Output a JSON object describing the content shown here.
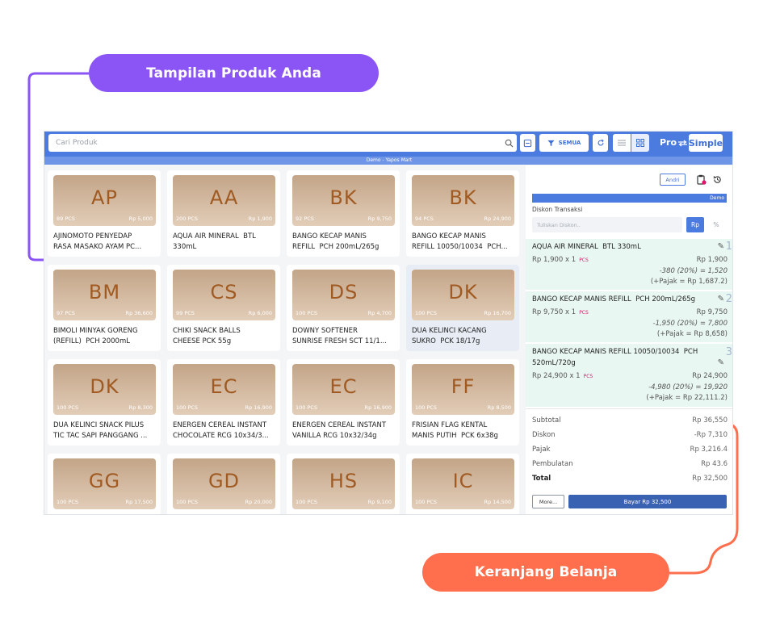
{
  "callouts": {
    "products": "Tampilan Produk Anda",
    "cart": "Keranjang Belanja"
  },
  "colors": {
    "callout_products": "#8b55f5",
    "callout_cart": "#ff6f4d",
    "brand_blue": "#4c7be0",
    "pcs_tag": "#e0136d"
  },
  "toolbar": {
    "search_placeholder": "Cari Produk",
    "filter_label": "SEMUA",
    "mode_pro": "Pro",
    "mode_simple": "Simple",
    "icons": [
      "search-icon",
      "barcode-icon",
      "filter-icon",
      "refresh-icon",
      "list-view-icon",
      "grid-view-icon",
      "toggle-icon"
    ]
  },
  "banner": "Demo - Yapos Mart",
  "products": [
    {
      "code": "AP",
      "qty": "89 PCS",
      "price": "Rp 5,000",
      "name": "AJINOMOTO PENYEDAP\nRASA MASAKO AYAM PC..."
    },
    {
      "code": "AA",
      "qty": "200 PCS",
      "price": "Rp 1,900",
      "name": "AQUA AIR MINERAL  BTL\n330mL"
    },
    {
      "code": "BK",
      "qty": "92 PCS",
      "price": "Rp 9,750",
      "name": "BANGO KECAP MANIS\nREFILL  PCH 200mL/265g"
    },
    {
      "code": "BK",
      "qty": "94 PCS",
      "price": "Rp 24,900",
      "name": "BANGO KECAP MANIS\nREFILL 10050/10034  PCH..."
    },
    {
      "code": "BM",
      "qty": "97 PCS",
      "price": "Rp 36,600",
      "name": "BIMOLI MINYAK GORENG\n(REFILL)  PCH 2000mL"
    },
    {
      "code": "CS",
      "qty": "99 PCS",
      "price": "Rp 6,000",
      "name": "CHIKI SNACK BALLS\nCHEESE PCK 55g"
    },
    {
      "code": "DS",
      "qty": "100 PCS",
      "price": "Rp 4,700",
      "name": "DOWNY SOFTENER\nSUNRISE FRESH SCT 11/1..."
    },
    {
      "code": "DK",
      "qty": "100 PCS",
      "price": "Rp 16,700",
      "name": "DUA KELINCI KACANG\nSUKRO  PCK 18/17g"
    },
    {
      "code": "DK",
      "qty": "100 PCS",
      "price": "Rp 8,300",
      "name": "DUA KELINCI SNACK PILUS\nTIC TAC SAPI PANGGANG ..."
    },
    {
      "code": "EC",
      "qty": "100 PCS",
      "price": "Rp 16,900",
      "name": "ENERGEN CEREAL INSTANT\nCHOCOLATE RCG 10x34/3..."
    },
    {
      "code": "EC",
      "qty": "100 PCS",
      "price": "Rp 16,900",
      "name": "ENERGEN CEREAL INSTANT\nVANILLA RCG 10x32/34g"
    },
    {
      "code": "FF",
      "qty": "100 PCS",
      "price": "Rp 8,500",
      "name": "FRISIAN FLAG KENTAL\nMANIS PUTIH  PCK 6x38g"
    },
    {
      "code": "GG",
      "qty": "100 PCS",
      "price": "Rp 17,500",
      "name": ""
    },
    {
      "code": "GD",
      "qty": "100 PCS",
      "price": "Rp 20,000",
      "name": ""
    },
    {
      "code": "HS",
      "qty": "100 PCS",
      "price": "Rp 9,100",
      "name": ""
    },
    {
      "code": "IC",
      "qty": "100 PCS",
      "price": "Rp 14,500",
      "name": ""
    }
  ],
  "cart": {
    "user": "Andri",
    "demo_label": "Demo",
    "discount_label": "Diskon Transaksi",
    "discount_placeholder": "Tuliskan Diskon..",
    "rp_label": "Rp",
    "pct_label": "%",
    "items": [
      {
        "no": "1",
        "name": "AQUA AIR MINERAL  BTL 330mL",
        "unit": "Rp 1,900 x 1",
        "tag": "PCS",
        "amount": "Rp 1,900",
        "discount": "-380 (20%) = 1,520",
        "tax": "(+Pajak = Rp 1,687.2)"
      },
      {
        "no": "2",
        "name": "BANGO KECAP MANIS REFILL  PCH 200mL/265g",
        "unit": "Rp 9,750 x 1",
        "tag": "PCS",
        "amount": "Rp 9,750",
        "discount": "-1,950 (20%) = 7,800",
        "tax": "(+Pajak = Rp 8,658)"
      },
      {
        "no": "3",
        "name": "BANGO KECAP MANIS REFILL 10050/10034  PCH\n520mL/720g",
        "unit": "Rp 24,900 x 1",
        "tag": "PCS",
        "amount": "Rp 24,900",
        "discount": "-4,980 (20%) = 19,920",
        "tax": "(+Pajak = Rp 22,111.2)"
      }
    ],
    "totals": {
      "subtotal_label": "Subtotal",
      "subtotal": "Rp 36,550",
      "discount_label": "Diskon",
      "discount": "-Rp 7,310",
      "tax_label": "Pajak",
      "tax": "Rp 3,216.4",
      "rounding_label": "Pembulatan",
      "rounding": "Rp 43.6",
      "total_label": "Total",
      "total": "Rp 32,500"
    },
    "more_label": "More...",
    "pay_label": "Bayar Rp 32,500"
  }
}
